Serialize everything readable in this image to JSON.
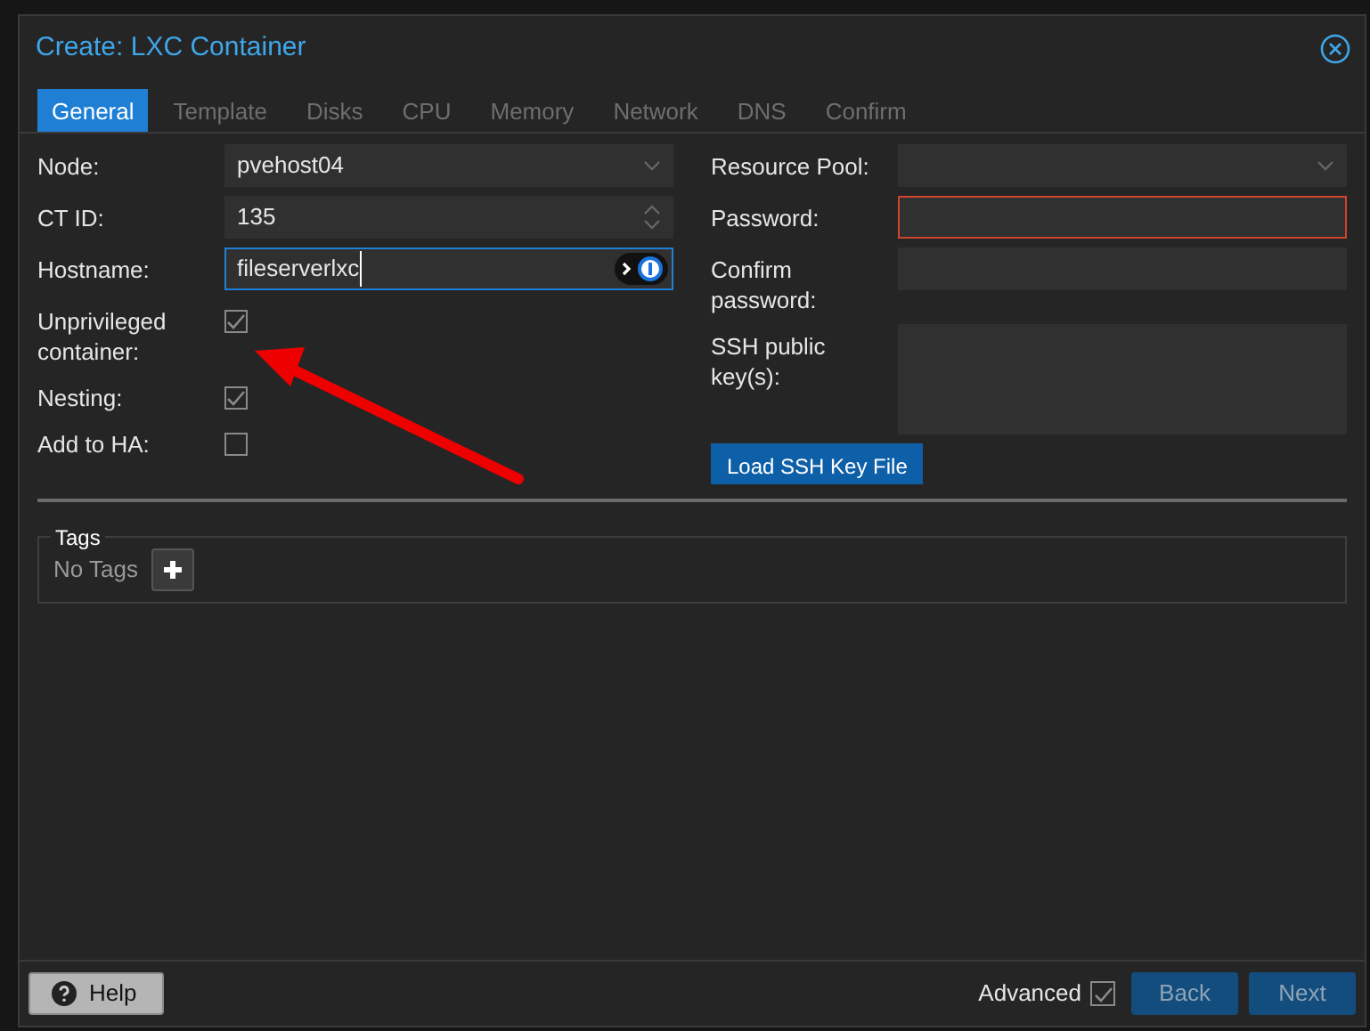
{
  "window": {
    "title": "Create: LXC Container"
  },
  "tabs": [
    {
      "label": "General",
      "selected": true,
      "disabled": false
    },
    {
      "label": "Template",
      "selected": false,
      "disabled": true
    },
    {
      "label": "Disks",
      "selected": false,
      "disabled": true
    },
    {
      "label": "CPU",
      "selected": false,
      "disabled": true
    },
    {
      "label": "Memory",
      "selected": false,
      "disabled": true
    },
    {
      "label": "Network",
      "selected": false,
      "disabled": true
    },
    {
      "label": "DNS",
      "selected": false,
      "disabled": true
    },
    {
      "label": "Confirm",
      "selected": false,
      "disabled": true
    }
  ],
  "left_fields": [
    {
      "kind": "combo",
      "label": "Node:",
      "value": "pvehost04"
    },
    {
      "kind": "spinner",
      "label": "CT ID:",
      "value": "135"
    },
    {
      "kind": "text",
      "label": "Hostname:",
      "value": "fileserverlxc",
      "focused": true
    },
    {
      "kind": "checkbox",
      "label": "Unprivileged container:",
      "checked": true
    },
    {
      "kind": "checkbox",
      "label": "Nesting:",
      "checked": true
    },
    {
      "kind": "checkbox",
      "label": "Add to HA:",
      "checked": false
    }
  ],
  "right_fields": [
    {
      "kind": "combo",
      "label": "Resource Pool:"
    },
    {
      "kind": "password",
      "label": "Password:",
      "invalid": true
    },
    {
      "kind": "password",
      "label": "Confirm password:",
      "invalid": false
    },
    {
      "kind": "textarea",
      "label": "SSH public key(s):"
    }
  ],
  "load_button": "Load SSH Key File",
  "tags": {
    "legend": "Tags",
    "empty_text": "No Tags"
  },
  "footer": {
    "help": "Help",
    "advanced": {
      "label": "Advanced",
      "checked": true
    },
    "buttons": [
      "Back",
      "Next"
    ]
  }
}
